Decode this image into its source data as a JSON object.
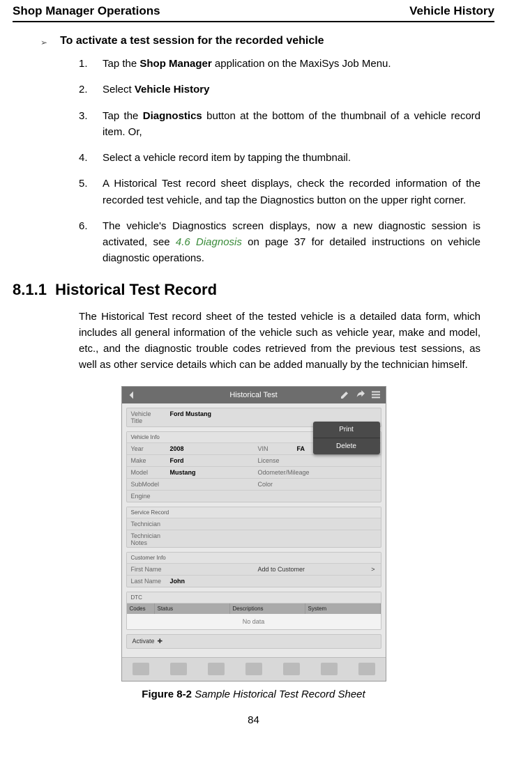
{
  "header": {
    "left": "Shop Manager Operations",
    "right": "Vehicle History"
  },
  "bullet": {
    "glyph": "➢",
    "text": "To activate a test session for the recorded vehicle"
  },
  "steps": {
    "s1": {
      "n": "1.",
      "pre": "Tap the ",
      "b": "Shop Manager",
      "post": " application on the MaxiSys Job Menu."
    },
    "s2": {
      "n": "2.",
      "pre": "Select ",
      "b": "Vehicle History"
    },
    "s3": {
      "n": "3.",
      "pre": "Tap the ",
      "b": "Diagnostics",
      "post": " button at the bottom of the thumbnail of a vehicle record item. Or,"
    },
    "s4": {
      "n": "4.",
      "txt": "Select a vehicle record item by tapping the thumbnail."
    },
    "s5": {
      "n": "5.",
      "txt": "A Historical Test record sheet displays, check the recorded information of the recorded test vehicle, and tap the Diagnostics button on the upper right corner."
    },
    "s6": {
      "n": "6.",
      "pre": "The vehicle's Diagnostics screen displays, now a new diagnostic session is activated, see ",
      "link": "4.6 Diagnosis",
      "post": " on page 37 for detailed instructions on vehicle diagnostic operations."
    }
  },
  "section": {
    "num": "8.1.1",
    "title": "Historical Test Record",
    "para": "The Historical Test record sheet of the tested vehicle is a detailed data form, which includes all general information of the vehicle such as vehicle year, make and model, etc., and the diagnostic trouble codes retrieved from the previous test sessions, as well as other service details which can be added manually by the technician himself."
  },
  "mock": {
    "title": "Historical Test",
    "menu": {
      "print": "Print",
      "delete": "Delete"
    },
    "vehTitle": {
      "lab": "Vehicle Title",
      "val": "Ford Mustang"
    },
    "vehInfo": {
      "lab": "Vehicle Info",
      "year": {
        "k": "Year",
        "v": "2008"
      },
      "make": {
        "k": "Make",
        "v": "Ford"
      },
      "model": {
        "k": "Model",
        "v": "Mustang"
      },
      "sub": {
        "k": "SubModel",
        "v": ""
      },
      "eng": {
        "k": "Engine",
        "v": ""
      },
      "vin": {
        "k": "VIN",
        "v": "FA"
      },
      "lic": {
        "k": "License",
        "v": ""
      },
      "odo": {
        "k": "Odometer/Mileage",
        "v": ""
      },
      "col": {
        "k": "Color",
        "v": ""
      }
    },
    "service": {
      "lab": "Service Record",
      "tech": "Technician",
      "notes": "Technician Notes"
    },
    "cust": {
      "lab": "Customer Info",
      "fn": {
        "k": "First Name",
        "v": ""
      },
      "ln": {
        "k": "Last Name",
        "v": "John"
      },
      "add": "Add to  Customer",
      "chev": ">"
    },
    "dtc": {
      "lab": "DTC",
      "h1": "Codes",
      "h2": "Status",
      "h3": "Descriptions",
      "h4": "System",
      "nodata": "No data"
    },
    "activate": "Activate"
  },
  "figure": {
    "label": "Figure 8-2 ",
    "caption": "Sample Historical Test Record Sheet"
  },
  "page": "84"
}
